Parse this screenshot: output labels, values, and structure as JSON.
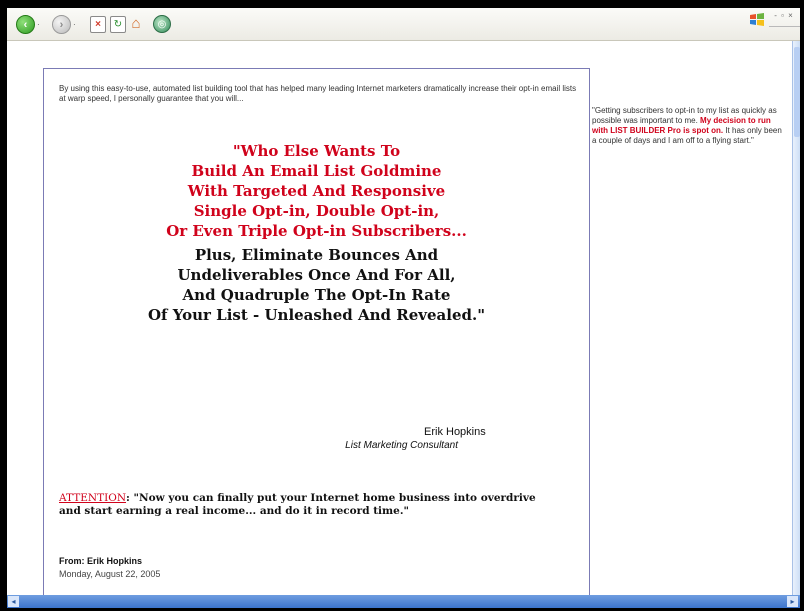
{
  "toolbar": {
    "back_icon": "back-arrow-icon",
    "forward_icon": "forward-arrow-icon",
    "stop_icon": "stop-icon",
    "refresh_icon": "refresh-icon",
    "home_icon": "home-icon",
    "media_icon": "media-icon",
    "back_glyph": "‹",
    "forward_glyph": "›",
    "dropdown_glyph": "·",
    "stop_glyph": "×",
    "refresh_glyph": "↻",
    "home_glyph": "⌂",
    "media_glyph": "◎",
    "window_controls": "- ▫ ×"
  },
  "main": {
    "intro": "By using this easy-to-use, automated list building tool that has helped many leading Internet marketers dramatically increase their opt-in email lists at warp speed, I personally guarantee that you will...",
    "headline_red": [
      "\"Who Else Wants To",
      "Build An Email List Goldmine",
      "With Targeted And Responsive",
      "Single Opt-in, Double Opt-in,",
      "Or Even Triple Opt-in Subscribers..."
    ],
    "headline_black": [
      "Plus, Eliminate Bounces And",
      "Undeliverables Once And For All,",
      "And Quadruple The Opt-In Rate",
      "Of Your List - Unleashed And Revealed.\""
    ],
    "signature_name": "Erik Hopkins",
    "signature_title": "List Marketing Consultant",
    "attention_label": "ATTENTION",
    "attention_text": ": \"Now you can finally put your Internet home business into overdrive and start earning a real income... and do it in record time.\"",
    "from_label": "From: Erik Hopkins",
    "date": "Monday, August 22, 2005"
  },
  "testimonial": {
    "text_before": "\"Getting subscribers to opt-in to my list as quickly as possible was important to me. ",
    "highlight": "My decision to run with LIST BUILDER Pro is spot on.",
    "text_after": " It has only been a couple of days and I am off to a flying start.\""
  },
  "colors": {
    "accent_red": "#d0021b",
    "card_border": "#7b7bb5",
    "scrollbar_blue": "#3c74cc"
  }
}
